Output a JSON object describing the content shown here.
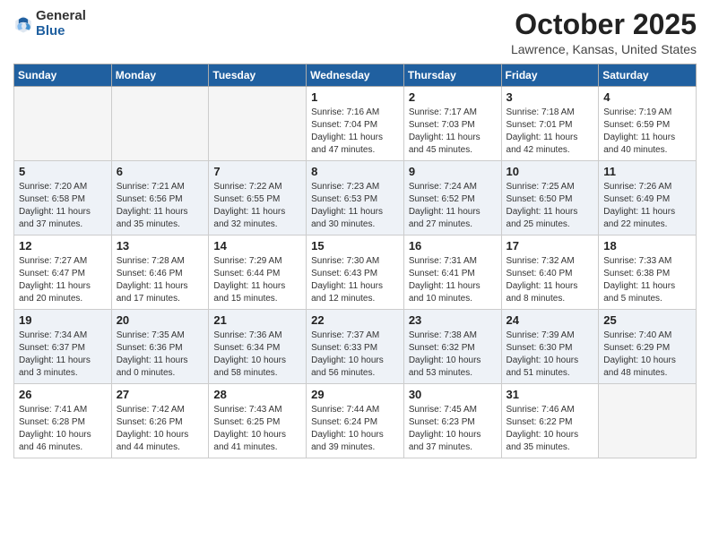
{
  "header": {
    "logo_general": "General",
    "logo_blue": "Blue",
    "month_title": "October 2025",
    "location": "Lawrence, Kansas, United States"
  },
  "weekdays": [
    "Sunday",
    "Monday",
    "Tuesday",
    "Wednesday",
    "Thursday",
    "Friday",
    "Saturday"
  ],
  "weeks": [
    [
      {
        "day": "",
        "empty": true
      },
      {
        "day": "",
        "empty": true
      },
      {
        "day": "",
        "empty": true
      },
      {
        "day": "1",
        "sunrise": "7:16 AM",
        "sunset": "7:04 PM",
        "daylight": "11 hours and 47 minutes."
      },
      {
        "day": "2",
        "sunrise": "7:17 AM",
        "sunset": "7:03 PM",
        "daylight": "11 hours and 45 minutes."
      },
      {
        "day": "3",
        "sunrise": "7:18 AM",
        "sunset": "7:01 PM",
        "daylight": "11 hours and 42 minutes."
      },
      {
        "day": "4",
        "sunrise": "7:19 AM",
        "sunset": "6:59 PM",
        "daylight": "11 hours and 40 minutes."
      }
    ],
    [
      {
        "day": "5",
        "sunrise": "7:20 AM",
        "sunset": "6:58 PM",
        "daylight": "11 hours and 37 minutes."
      },
      {
        "day": "6",
        "sunrise": "7:21 AM",
        "sunset": "6:56 PM",
        "daylight": "11 hours and 35 minutes."
      },
      {
        "day": "7",
        "sunrise": "7:22 AM",
        "sunset": "6:55 PM",
        "daylight": "11 hours and 32 minutes."
      },
      {
        "day": "8",
        "sunrise": "7:23 AM",
        "sunset": "6:53 PM",
        "daylight": "11 hours and 30 minutes."
      },
      {
        "day": "9",
        "sunrise": "7:24 AM",
        "sunset": "6:52 PM",
        "daylight": "11 hours and 27 minutes."
      },
      {
        "day": "10",
        "sunrise": "7:25 AM",
        "sunset": "6:50 PM",
        "daylight": "11 hours and 25 minutes."
      },
      {
        "day": "11",
        "sunrise": "7:26 AM",
        "sunset": "6:49 PM",
        "daylight": "11 hours and 22 minutes."
      }
    ],
    [
      {
        "day": "12",
        "sunrise": "7:27 AM",
        "sunset": "6:47 PM",
        "daylight": "11 hours and 20 minutes."
      },
      {
        "day": "13",
        "sunrise": "7:28 AM",
        "sunset": "6:46 PM",
        "daylight": "11 hours and 17 minutes."
      },
      {
        "day": "14",
        "sunrise": "7:29 AM",
        "sunset": "6:44 PM",
        "daylight": "11 hours and 15 minutes."
      },
      {
        "day": "15",
        "sunrise": "7:30 AM",
        "sunset": "6:43 PM",
        "daylight": "11 hours and 12 minutes."
      },
      {
        "day": "16",
        "sunrise": "7:31 AM",
        "sunset": "6:41 PM",
        "daylight": "11 hours and 10 minutes."
      },
      {
        "day": "17",
        "sunrise": "7:32 AM",
        "sunset": "6:40 PM",
        "daylight": "11 hours and 8 minutes."
      },
      {
        "day": "18",
        "sunrise": "7:33 AM",
        "sunset": "6:38 PM",
        "daylight": "11 hours and 5 minutes."
      }
    ],
    [
      {
        "day": "19",
        "sunrise": "7:34 AM",
        "sunset": "6:37 PM",
        "daylight": "11 hours and 3 minutes."
      },
      {
        "day": "20",
        "sunrise": "7:35 AM",
        "sunset": "6:36 PM",
        "daylight": "11 hours and 0 minutes."
      },
      {
        "day": "21",
        "sunrise": "7:36 AM",
        "sunset": "6:34 PM",
        "daylight": "10 hours and 58 minutes."
      },
      {
        "day": "22",
        "sunrise": "7:37 AM",
        "sunset": "6:33 PM",
        "daylight": "10 hours and 56 minutes."
      },
      {
        "day": "23",
        "sunrise": "7:38 AM",
        "sunset": "6:32 PM",
        "daylight": "10 hours and 53 minutes."
      },
      {
        "day": "24",
        "sunrise": "7:39 AM",
        "sunset": "6:30 PM",
        "daylight": "10 hours and 51 minutes."
      },
      {
        "day": "25",
        "sunrise": "7:40 AM",
        "sunset": "6:29 PM",
        "daylight": "10 hours and 48 minutes."
      }
    ],
    [
      {
        "day": "26",
        "sunrise": "7:41 AM",
        "sunset": "6:28 PM",
        "daylight": "10 hours and 46 minutes."
      },
      {
        "day": "27",
        "sunrise": "7:42 AM",
        "sunset": "6:26 PM",
        "daylight": "10 hours and 44 minutes."
      },
      {
        "day": "28",
        "sunrise": "7:43 AM",
        "sunset": "6:25 PM",
        "daylight": "10 hours and 41 minutes."
      },
      {
        "day": "29",
        "sunrise": "7:44 AM",
        "sunset": "6:24 PM",
        "daylight": "10 hours and 39 minutes."
      },
      {
        "day": "30",
        "sunrise": "7:45 AM",
        "sunset": "6:23 PM",
        "daylight": "10 hours and 37 minutes."
      },
      {
        "day": "31",
        "sunrise": "7:46 AM",
        "sunset": "6:22 PM",
        "daylight": "10 hours and 35 minutes."
      },
      {
        "day": "",
        "empty": true
      }
    ]
  ]
}
